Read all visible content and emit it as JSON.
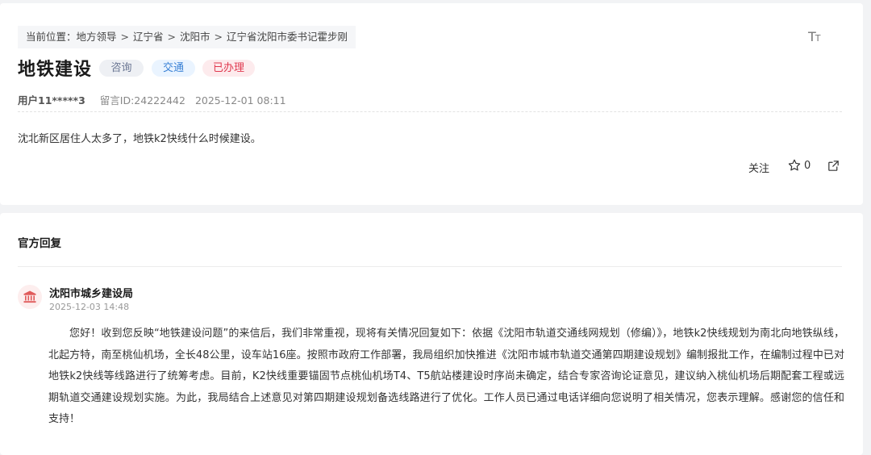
{
  "breadcrumb": {
    "prefix": "当前位置：",
    "items": [
      "地方领导",
      "辽宁省",
      "沈阳市",
      "辽宁省沈阳市委书记霍步刚"
    ],
    "separator": ">"
  },
  "font_size_control": {
    "label_big": "T",
    "label_small": "T",
    "icon": "font-size-icon"
  },
  "message": {
    "title": "地铁建设",
    "tags": [
      "咨询",
      "交通",
      "已办理"
    ],
    "user": "用户11*****3",
    "message_id": "留言ID:24222442",
    "datetime": "2025-12-01 08:11",
    "content": "沈北新区居住人太多了，地铁k2快线什么时候建设。"
  },
  "actions": {
    "follow_label": "关注",
    "star_count": "0",
    "star_icon": "star-icon",
    "share_icon": "share-icon"
  },
  "reply": {
    "section_title": "官方回复",
    "org_name": "沈阳市城乡建设局",
    "org_icon": "government-building-icon",
    "datetime": "2025-12-03 14:48",
    "content": "您好！收到您反映“地铁建设问题”的来信后，我们非常重视，现将有关情况回复如下：依据《沈阳市轨道交通线网规划（修编）》，地铁k2快线规划为南北向地铁纵线，北起方特，南至桃仙机场，全长48公里，设车站16座。按照市政府工作部署，我局组织加快推进《沈阳市城市轨道交通第四期建设规划》编制报批工作，在编制过程中已对地铁k2快线等线路进行了统筹考虑。目前，K2快线重要锚固节点桃仙机场T4、T5航站楼建设时序尚未确定，结合专家咨询论证意见，建议纳入桃仙机场后期配套工程或远期轨道交通建设规划实施。为此，我局结合上述意见对第四期建设规划备选线路进行了优化。工作人员已通过电话详细向您说明了相关情况，您表示理解。感谢您的信任和支持！"
  },
  "colors": {
    "tag_consult": "#6b7794",
    "tag_traffic": "#3b82d6",
    "tag_done": "#e0394f",
    "org_icon": "#e05a5a"
  }
}
